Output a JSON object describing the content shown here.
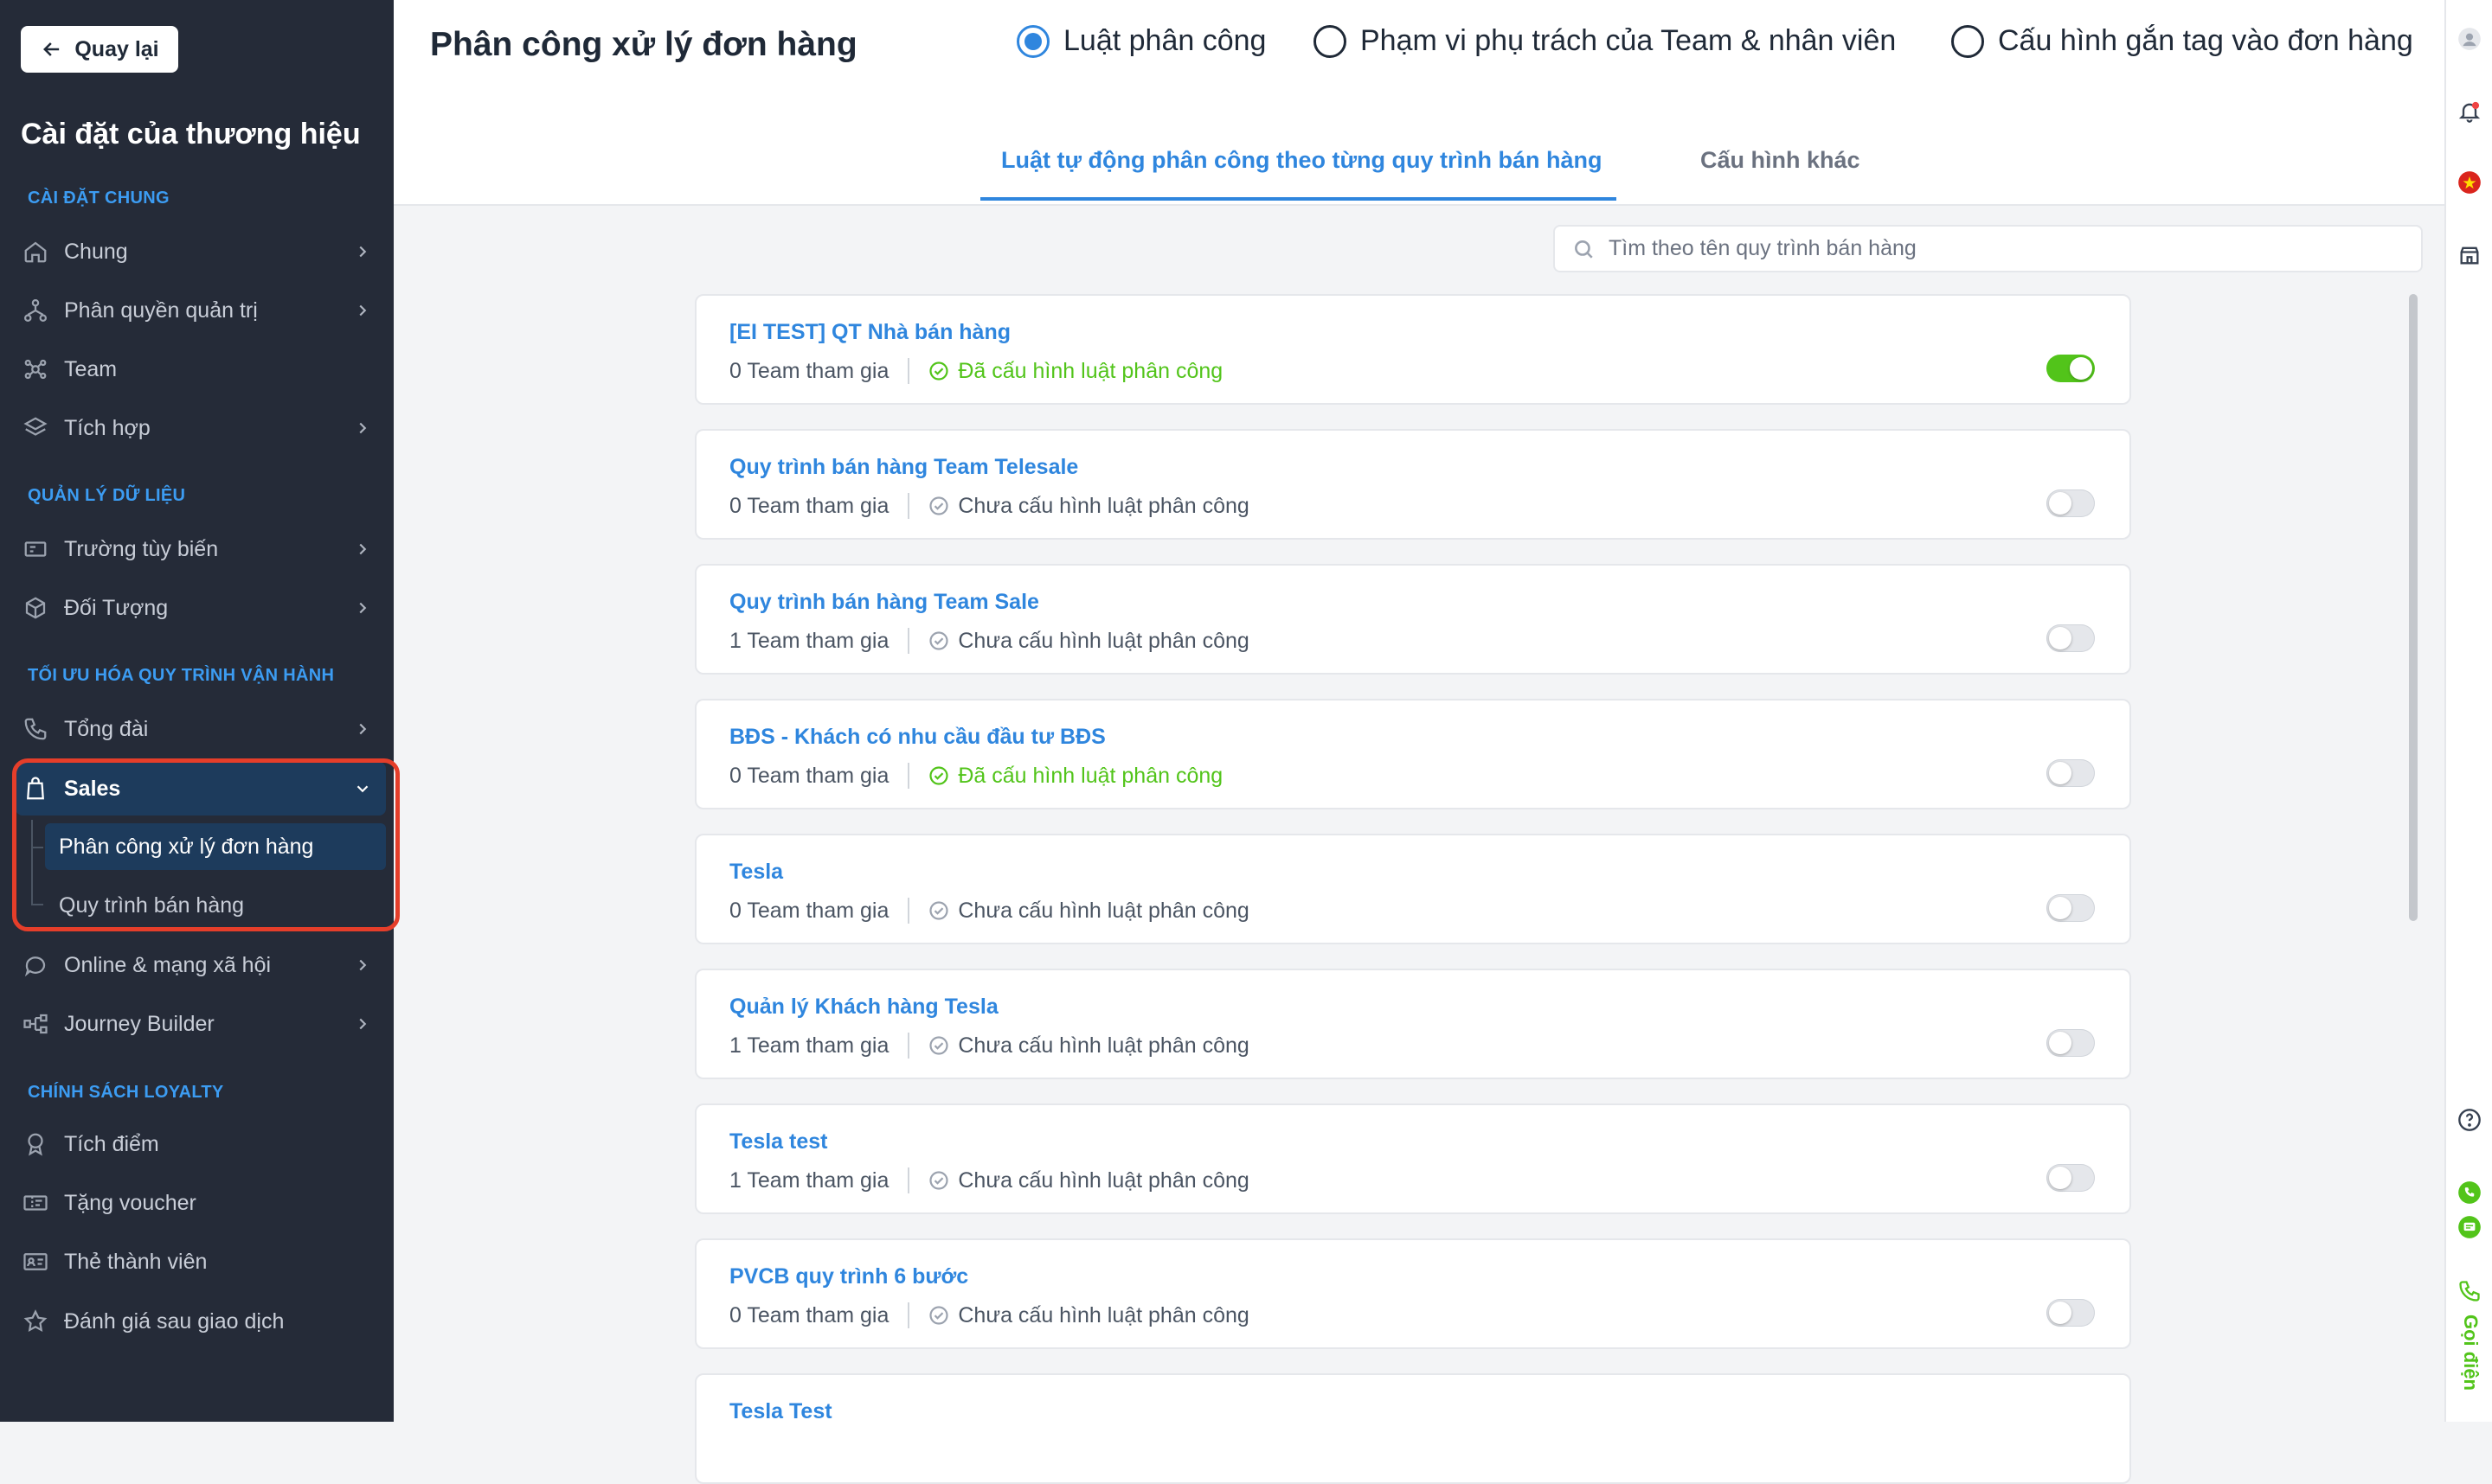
{
  "sidebar": {
    "back_label": "Quay lại",
    "brand_title": "Cài đặt của thương hiệu",
    "sections": {
      "general": "CÀI ĐẶT CHUNG",
      "data": "QUẢN LÝ DỮ LIỆU",
      "optimize": "TỐI ƯU HÓA QUY TRÌNH VẬN HÀNH",
      "loyalty": "CHÍNH SÁCH LOYALTY"
    },
    "items": {
      "chung": "Chung",
      "phan_quyen": "Phân quyền quản trị",
      "team": "Team",
      "tich_hop": "Tích hợp",
      "truong_tuy_bien": "Trường tùy biến",
      "doi_tuong": "Đối Tượng",
      "tong_dai": "Tổng đài",
      "sales": "Sales",
      "phan_cong": "Phân công xử lý đơn hàng",
      "quy_trinh": "Quy trình bán hàng",
      "online": "Online & mạng xã hội",
      "journey": "Journey Builder",
      "tich_diem": "Tích điểm",
      "tang_voucher": "Tặng voucher",
      "the_thanh_vien": "Thẻ thành viên",
      "danh_gia": "Đánh giá sau giao dịch"
    }
  },
  "header": {
    "title": "Phân công xử lý đơn hàng",
    "radios": [
      "Luật phân công",
      "Phạm vi phụ trách của Team & nhân viên",
      "Cấu hình gắn tag vào đơn hàng"
    ],
    "selected_radio": "Luật phân công",
    "tabs": [
      "Luật tự động phân công theo từng quy trình bán hàng",
      "Cấu hình khác"
    ]
  },
  "search": {
    "placeholder": "Tìm theo tên quy trình bán hàng"
  },
  "processes": [
    {
      "name": "[EI TEST] QT Nhà bán hàng",
      "teams": "0 Team tham gia",
      "status": "Đã cấu hình luật phân công",
      "configured": true,
      "enabled": true
    },
    {
      "name": "Quy trình bán hàng Team Telesale",
      "teams": "0 Team tham gia",
      "status": "Chưa cấu hình luật phân công",
      "configured": false,
      "enabled": false
    },
    {
      "name": "Quy trình bán hàng Team Sale",
      "teams": "1 Team tham gia",
      "status": "Chưa cấu hình luật phân công",
      "configured": false,
      "enabled": false
    },
    {
      "name": "BĐS - Khách có nhu cầu đầu tư BĐS",
      "teams": "0 Team tham gia",
      "status": "Đã cấu hình luật phân công",
      "configured": true,
      "enabled": false
    },
    {
      "name": "Tesla",
      "teams": "0 Team tham gia",
      "status": "Chưa cấu hình luật phân công",
      "configured": false,
      "enabled": false
    },
    {
      "name": "Quản lý Khách hàng Tesla",
      "teams": "1 Team tham gia",
      "status": "Chưa cấu hình luật phân công",
      "configured": false,
      "enabled": false
    },
    {
      "name": "Tesla test",
      "teams": "1 Team tham gia",
      "status": "Chưa cấu hình luật phân công",
      "configured": false,
      "enabled": false
    },
    {
      "name": "PVCB quy trình 6 bước",
      "teams": "0 Team tham gia",
      "status": "Chưa cấu hình luật phân công",
      "configured": false,
      "enabled": false
    },
    {
      "name": "Tesla Test"
    }
  ],
  "rightbar": {
    "call_label": "Gọi điện"
  },
  "colors": {
    "accent": "#2f86de",
    "success": "#52c41a",
    "sidebar_bg": "#252b38",
    "highlight": "#e53e2a"
  }
}
